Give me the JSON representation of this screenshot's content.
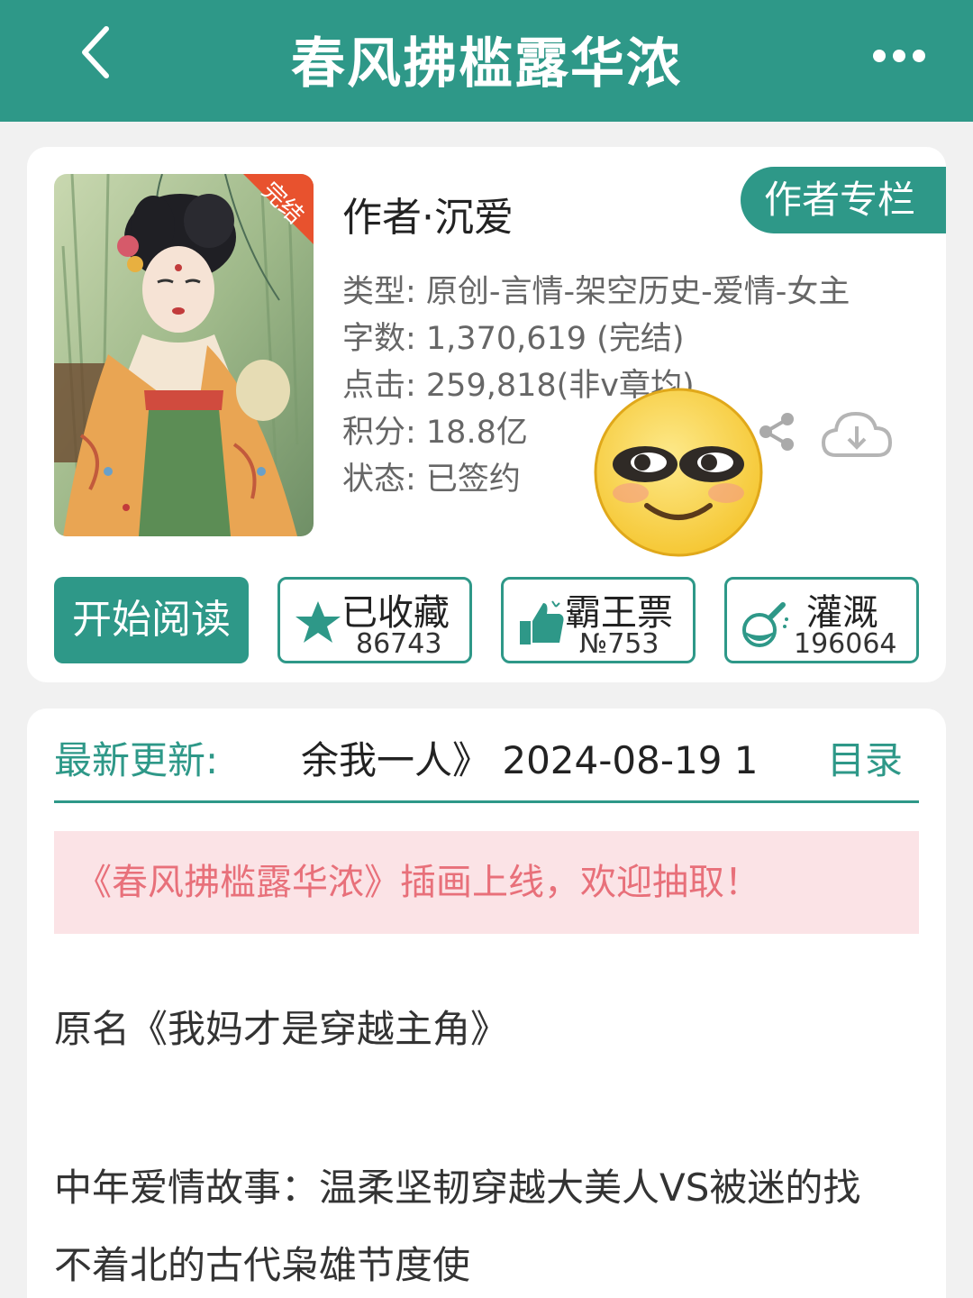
{
  "header": {
    "title": "春风拂槛露华浓",
    "back_icon": "chevron-left-icon",
    "more_icon": "more-dots-icon"
  },
  "book": {
    "author_line": "作者·沉爱",
    "author_column_label": "作者专栏",
    "cover_badge": "完结",
    "info": {
      "type": "类型: 原创-言情-架空历史-爱情-女主",
      "words": "字数: 1,370,619 (完结)",
      "clicks": "点击: 259,818(非v章均)",
      "score": "积分: 18.8亿",
      "status": "状态: 已签约"
    },
    "share_icon": "share-icon",
    "download_icon": "cloud-download-icon"
  },
  "actions": {
    "start_read": "开始阅读",
    "collect": {
      "label": "已收藏",
      "count": "86743",
      "icon": "star-icon"
    },
    "vote": {
      "label": "霸王票",
      "count": "№753",
      "icon": "thumbs-up-icon"
    },
    "water": {
      "label": "灌溉",
      "count": "196064",
      "icon": "watering-flask-icon"
    }
  },
  "latest": {
    "label": "最新更新:",
    "value": "余我一人》 2024-08-19 1",
    "toc": "目录"
  },
  "notice": "《春风拂槛露华浓》插画上线，欢迎抽取！",
  "description": {
    "line1": "原名《我妈才是穿越主角》",
    "line2": "中年爱情故事：温柔坚韧穿越大美人VS被迷的找",
    "line3": "不着北的古代枭雄节度使"
  },
  "colors": {
    "accent": "#2e9888",
    "notice_bg": "#fbe3e6",
    "notice_text": "#e8707a",
    "badge": "#e8522e"
  }
}
